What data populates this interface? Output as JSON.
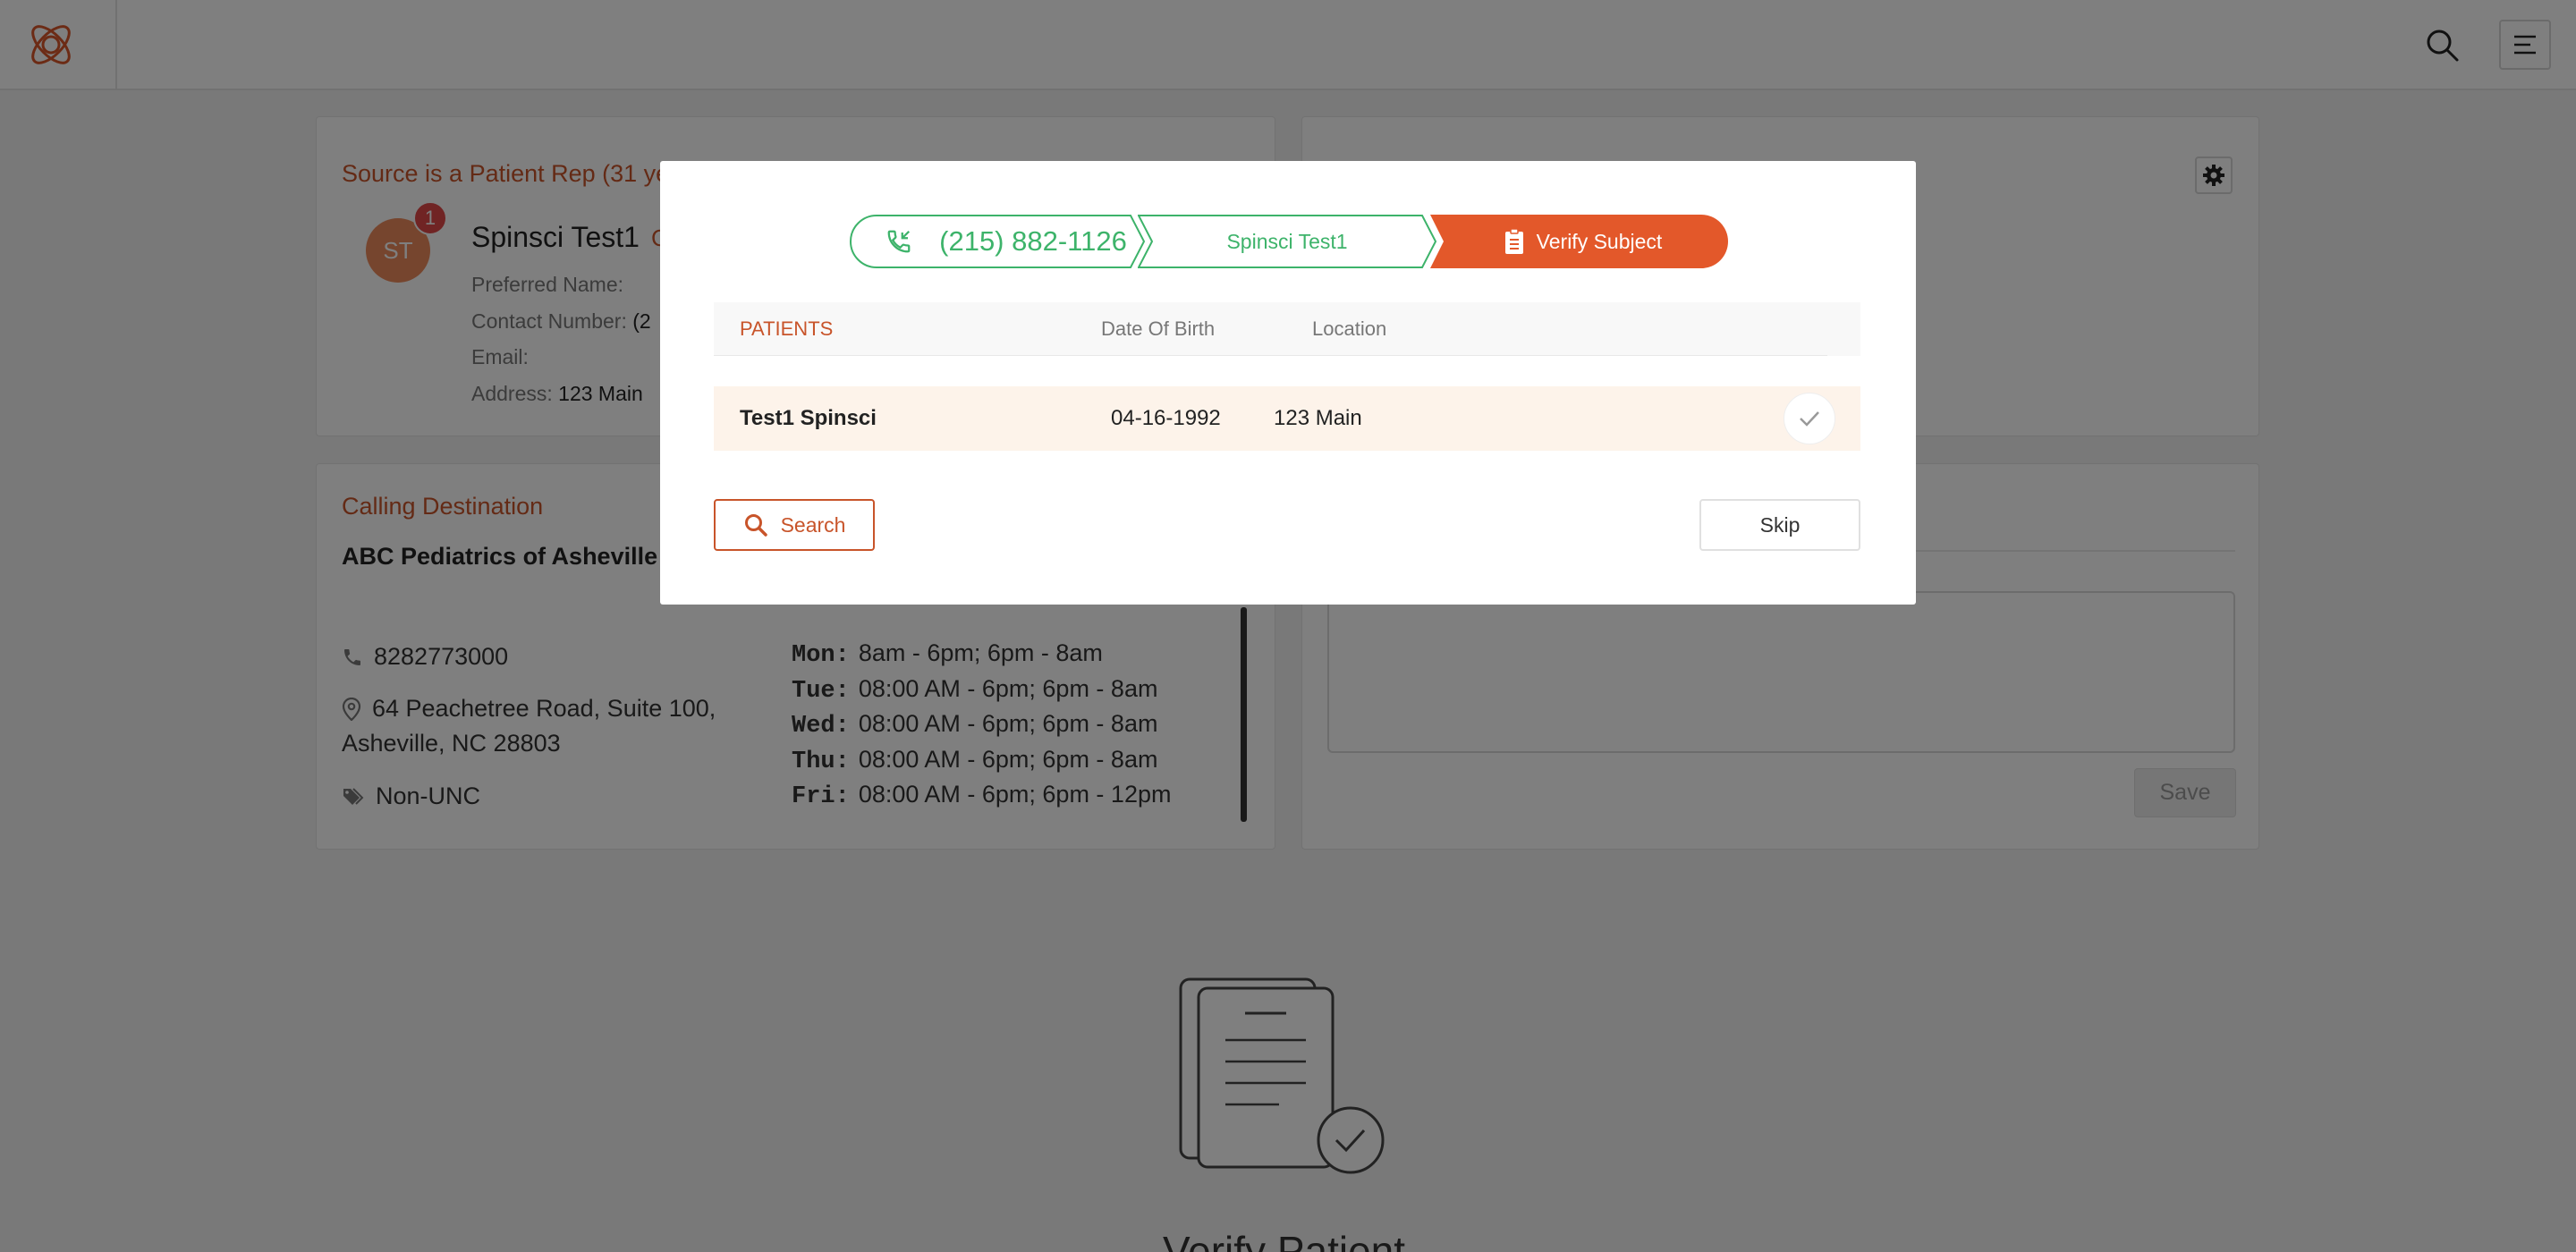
{
  "header": {
    "logo_icon": "knot-logo-icon",
    "search_icon": "search-icon",
    "menu_icon": "hamburger-menu-icon"
  },
  "source_card": {
    "title": "Source is a Patient Rep (31 ye",
    "avatar_initials": "ST",
    "notification_count": "1",
    "patient_name": "Spinsci Test1",
    "name_link": "C",
    "preferred_name_label": "Preferred Name:",
    "preferred_name_value": "",
    "contact_number_label": "Contact Number:",
    "contact_number_value": "(2",
    "email_label": "Email:",
    "email_value": "",
    "address_label": "Address:",
    "address_value": "123 Main"
  },
  "right_top_card": {
    "settings_icon": "gear-icon"
  },
  "calling_card": {
    "title": "Calling Destination",
    "destination_name": "ABC Pediatrics of Asheville",
    "phone": "8282773000",
    "address_line1": "64 Peachetree Road, Suite 100,",
    "address_line2": "Asheville, NC 28803",
    "tag": "Non-UNC",
    "hours": [
      {
        "day": "Mon:",
        "time": "8am - 6pm; 6pm - 8am"
      },
      {
        "day": "Tue:",
        "time": "08:00 AM - 6pm; 6pm - 8am"
      },
      {
        "day": "Wed:",
        "time": "08:00 AM - 6pm; 6pm - 8am"
      },
      {
        "day": "Thu:",
        "time": "08:00 AM - 6pm; 6pm - 8am"
      },
      {
        "day": "Fri:",
        "time": "08:00 AM - 6pm; 6pm - 12pm"
      }
    ]
  },
  "right_bottom_card": {
    "save_label": "Save"
  },
  "empty_state": {
    "title": "Verify Patient",
    "illustration_icon": "document-check-icon"
  },
  "modal": {
    "steps": [
      {
        "label": "(215) 882-1126",
        "icon": "phone-incoming-icon",
        "state": "done"
      },
      {
        "label": "Spinsci Test1",
        "state": "done"
      },
      {
        "label": "Verify Subject",
        "icon": "id-badge-icon",
        "state": "active"
      }
    ],
    "columns": [
      "PATIENTS",
      "Date Of Birth",
      "Location"
    ],
    "rows": [
      {
        "name": "Test1 Spinsci",
        "dob": "04-16-1992",
        "location": "123 Main",
        "selected": true
      }
    ],
    "search_label": "Search",
    "skip_label": "Skip"
  },
  "colors": {
    "accent_orange": "#c8542a",
    "step_active": "#e3582a",
    "step_done": "#3db36a",
    "overlay": "rgba(0,0,0,0.5)"
  }
}
